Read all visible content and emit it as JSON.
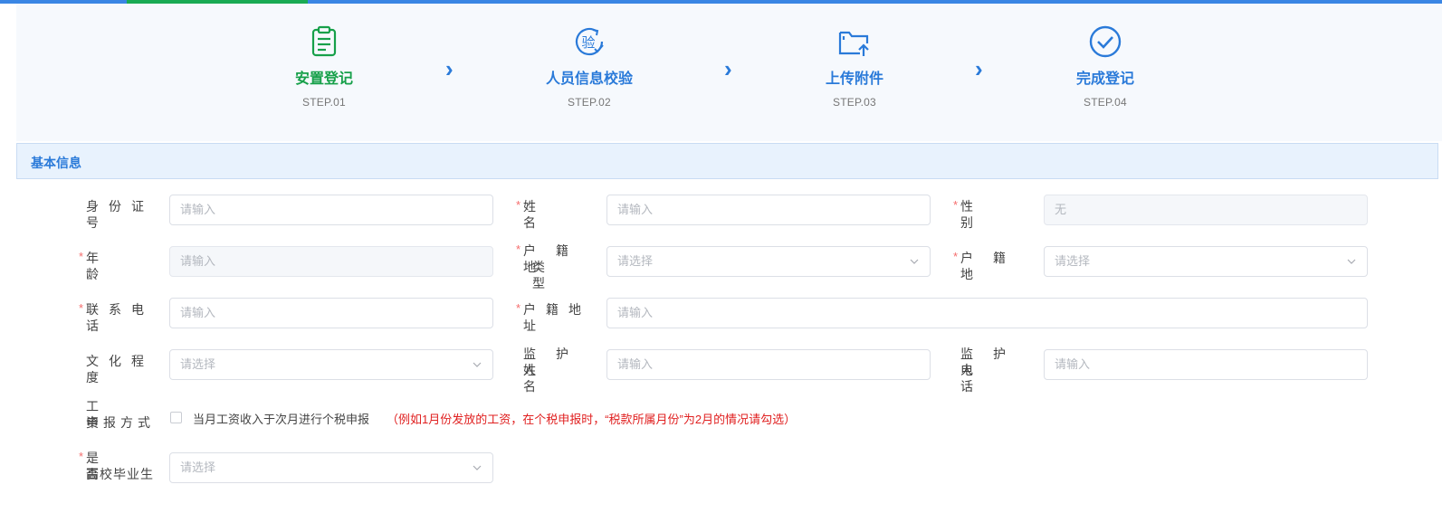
{
  "steps": [
    {
      "title": "安置登记",
      "sub": "STEP.01",
      "icon": "clipboard-icon"
    },
    {
      "title": "人员信息校验",
      "sub": "STEP.02",
      "icon": "verify-icon"
    },
    {
      "title": "上传附件",
      "sub": "STEP.03",
      "icon": "upload-folder-icon"
    },
    {
      "title": "完成登记",
      "sub": "STEP.04",
      "icon": "check-circle-icon"
    }
  ],
  "arrow": "›",
  "section": {
    "title": "基本信息"
  },
  "required_mark": "*",
  "form": {
    "id_number": {
      "label": "身份证号",
      "placeholder": "请输入"
    },
    "name": {
      "label": "姓名",
      "placeholder": "请输入"
    },
    "gender": {
      "label": "性别",
      "value": "无"
    },
    "age": {
      "label": "年龄",
      "placeholder": "请输入"
    },
    "household_type": {
      "label_line1": "户籍地",
      "label_line2": "类型",
      "placeholder": "请选择"
    },
    "household_place": {
      "label": "户籍地",
      "placeholder": "请选择"
    },
    "phone": {
      "label": "联系电话",
      "placeholder": "请输入"
    },
    "household_address": {
      "label": "户籍地址",
      "placeholder": "请输入"
    },
    "education": {
      "label": "文化程度",
      "placeholder": "请选择"
    },
    "guardian_name": {
      "label_line1": "监护人",
      "label_line2": "姓名",
      "placeholder": "请输入"
    },
    "guardian_phone": {
      "label_line1": "监护人",
      "label_line2": "电话",
      "placeholder": "请输入"
    },
    "salary_method": {
      "label_line1": "工资",
      "label_line2": "申报方式",
      "checkbox_text": "当月工资收入于次月进行个税申报",
      "note": "（例如1月份发放的工资，在个税申报时，“税款所属月份”为2月的情况请勾选）"
    },
    "graduate": {
      "label_line1": "是否",
      "label_line2": "高校毕业生",
      "placeholder": "请选择"
    }
  }
}
